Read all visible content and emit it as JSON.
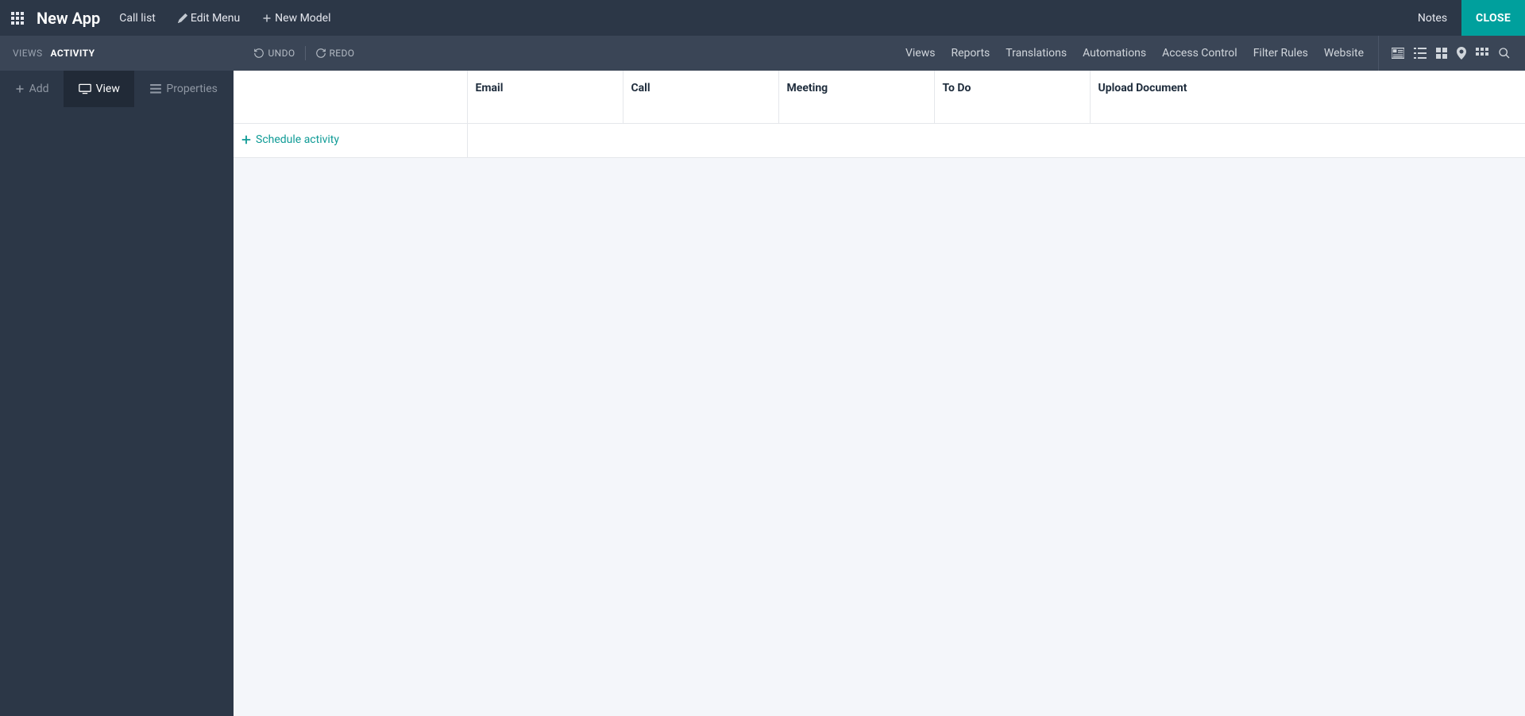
{
  "header": {
    "app_title": "New App",
    "call_list": "Call list",
    "edit_menu": "Edit Menu",
    "new_model": "New Model",
    "notes": "Notes",
    "close": "CLOSE"
  },
  "subbar": {
    "views_label": "VIEWS",
    "activity_label": "ACTIVITY",
    "undo": "UNDO",
    "redo": "REDO",
    "nav": {
      "views": "Views",
      "reports": "Reports",
      "translations": "Translations",
      "automations": "Automations",
      "access_control": "Access Control",
      "filter_rules": "Filter Rules",
      "website": "Website"
    }
  },
  "side_tabs": {
    "add": "Add",
    "view": "View",
    "properties": "Properties"
  },
  "columns": {
    "blank": "",
    "email": "Email",
    "call": "Call",
    "meeting": "Meeting",
    "todo": "To Do",
    "upload_document": "Upload Document"
  },
  "actions": {
    "schedule_activity": "Schedule activity"
  }
}
